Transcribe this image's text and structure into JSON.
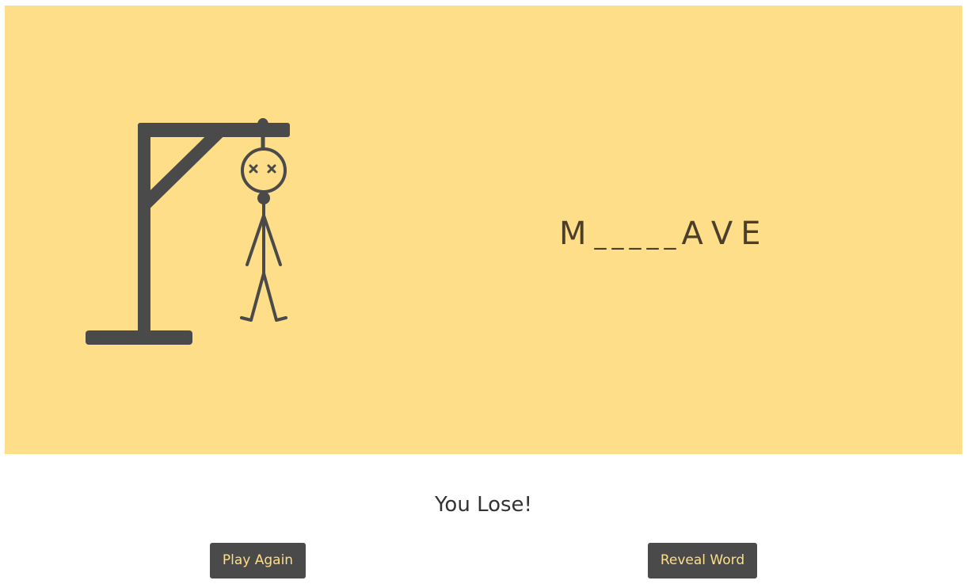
{
  "game": {
    "word_slots": [
      "M",
      "_",
      "_",
      "_",
      "_",
      "_",
      "A",
      "V",
      "E"
    ],
    "result_message": "You Lose!",
    "colors": {
      "stage_background": "#fede88",
      "figure": "#4a4a4a",
      "letters": "#4b3f2c",
      "button_background": "#4a4a4a",
      "button_text": "#fede88"
    },
    "figure_state": "dead-face-x-eyes"
  },
  "buttons": {
    "play_again_label": "Play Again",
    "reveal_word_label": "Reveal Word"
  }
}
